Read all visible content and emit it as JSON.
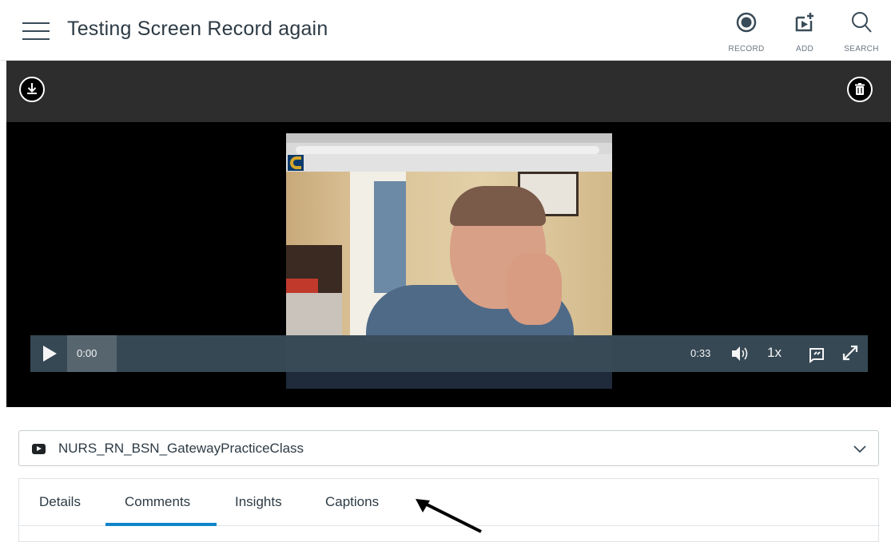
{
  "header": {
    "title": "Testing Screen Record again",
    "actions": [
      {
        "label": "RECORD",
        "icon": "record-icon"
      },
      {
        "label": "ADD",
        "icon": "add-media-icon"
      },
      {
        "label": "SEARCH",
        "icon": "search-icon"
      }
    ]
  },
  "player": {
    "toolbar": {
      "download_icon": "download-icon",
      "delete_icon": "trash-icon"
    },
    "current_time": "0:00",
    "duration": "0:33",
    "speed": "1x",
    "progress": 0
  },
  "channel": {
    "name": "NURS_RN_BSN_GatewayPracticeClass",
    "icon": "video-icon"
  },
  "tabs": [
    {
      "label": "Details"
    },
    {
      "label": "Comments",
      "active": true
    },
    {
      "label": "Insights"
    },
    {
      "label": "Captions"
    }
  ],
  "colors": {
    "accent": "#0e85c9",
    "control_bar": "#394b58",
    "header_dark": "#2d2d2d"
  }
}
